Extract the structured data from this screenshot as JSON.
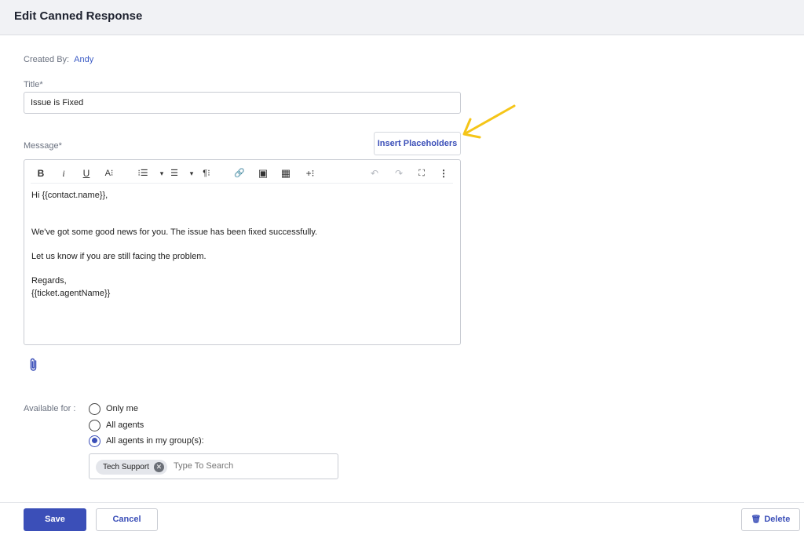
{
  "header": {
    "title": "Edit Canned Response"
  },
  "meta": {
    "created_by_label": "Created By:",
    "created_by_value": "Andy"
  },
  "title_field": {
    "label": "Title*",
    "value": "Issue is Fixed"
  },
  "message": {
    "label": "Message*",
    "insert_placeholders_label": "Insert Placeholders",
    "toolbar": {
      "bold": "B",
      "italic": "i",
      "underline": "U",
      "font_size": "A⁝",
      "ordered_list": "⁝☰",
      "ordered_list_caret": "▾",
      "bullet_list": "☰",
      "bullet_list_caret": "▾",
      "paragraph": "¶⁝",
      "link": "🔗",
      "image": "▣",
      "table": "▦",
      "insert_more": "+⁝",
      "undo": "↶",
      "redo": "↷",
      "fullscreen": "⛶",
      "more": "⋮"
    },
    "body": {
      "greeting": "Hi {{contact.name}},",
      "line1": "We've got some good news for you. The issue has been fixed successfully.",
      "line2": "Let us know if you are still facing the problem.",
      "closing": "Regards,",
      "signature": "{{ticket.agentName}}"
    }
  },
  "availability": {
    "label": "Available for :",
    "options": [
      {
        "label": "Only me",
        "selected": false
      },
      {
        "label": "All agents",
        "selected": false
      },
      {
        "label": "All agents in my group(s):",
        "selected": true
      }
    ],
    "groups": {
      "chips": [
        "Tech Support"
      ],
      "search_placeholder": "Type To Search"
    }
  },
  "footer": {
    "save_label": "Save",
    "cancel_label": "Cancel",
    "delete_label": "Delete"
  },
  "colors": {
    "accent": "#3b4fb8",
    "link": "#3b5bc5",
    "annotation_arrow": "#f5c518"
  }
}
